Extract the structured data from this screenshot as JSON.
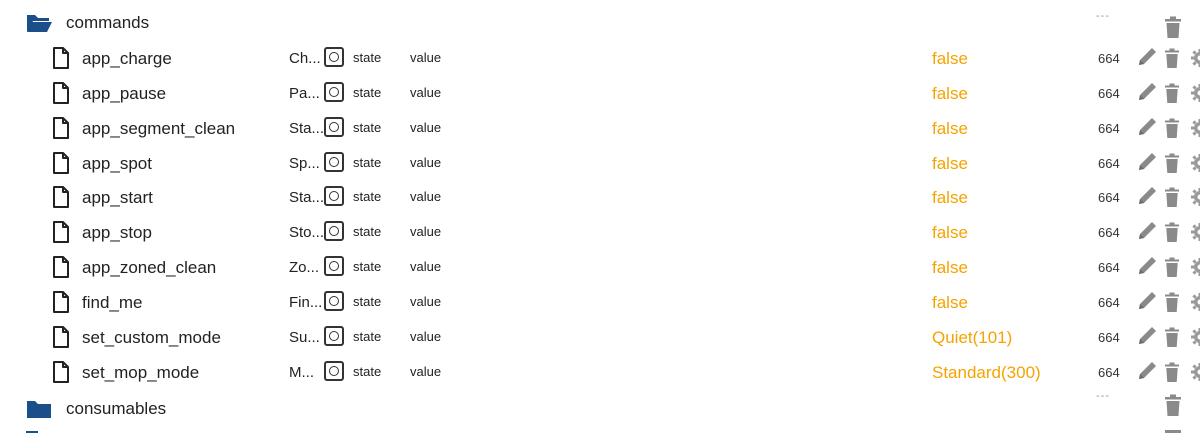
{
  "folders": {
    "commands": {
      "label": "commands",
      "dash": "---"
    },
    "consumables": {
      "label": "consumables",
      "dash": "---"
    }
  },
  "columns": {
    "role": "state",
    "type": "value"
  },
  "items": [
    {
      "name": "app_charge",
      "title": "Ch...",
      "value": "false",
      "unit": "",
      "acl": "664"
    },
    {
      "name": "app_pause",
      "title": "Pa...",
      "value": "false",
      "unit": "",
      "acl": "664"
    },
    {
      "name": "app_segment_clean",
      "title": "Sta...",
      "value": "false",
      "unit": "",
      "acl": "664"
    },
    {
      "name": "app_spot",
      "title": "Sp...",
      "value": "false",
      "unit": "",
      "acl": "664"
    },
    {
      "name": "app_start",
      "title": "Sta...",
      "value": "false",
      "unit": "",
      "acl": "664"
    },
    {
      "name": "app_stop",
      "title": "Sto...",
      "value": "false",
      "unit": "",
      "acl": "664"
    },
    {
      "name": "app_zoned_clean",
      "title": "Zo...",
      "value": "false",
      "unit": "",
      "acl": "664"
    },
    {
      "name": "find_me",
      "title": "Fin...",
      "value": "false",
      "unit": "",
      "acl": "664"
    },
    {
      "name": "set_custom_mode",
      "title": "Su...",
      "value": "Quiet",
      "unit": "(101)",
      "acl": "664"
    },
    {
      "name": "set_mop_mode",
      "title": "M...",
      "value": "Standard",
      "unit": "(300)",
      "acl": "664"
    }
  ],
  "colors": {
    "folder": "#1a4f8a",
    "value": "#f5a300",
    "icon": "#8a8a8a"
  },
  "icons": {
    "folder_open": "folder-open-icon",
    "folder_closed": "folder-icon",
    "file": "file-icon",
    "edit": "pencil-icon",
    "delete": "trash-icon",
    "settings": "gear-icon"
  }
}
